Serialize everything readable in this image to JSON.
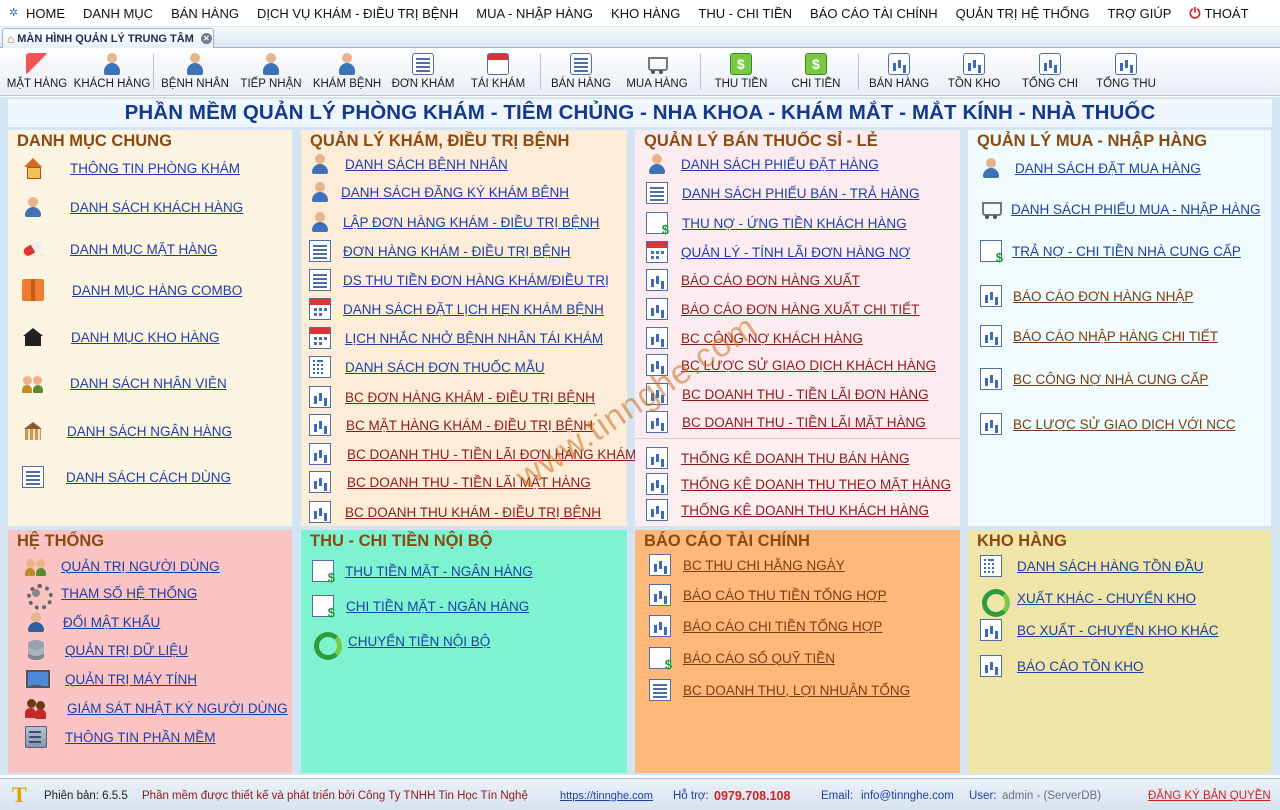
{
  "menu": {
    "items": [
      "HOME",
      "DANH MỤC",
      "BÁN HÀNG",
      "DỊCH VỤ KHÁM - ĐIỀU TRỊ BỆNH",
      "MUA - NHẬP HÀNG",
      "KHO HÀNG",
      "THU - CHI TIỀN",
      "BÁO CÁO TÀI CHÍNH",
      "QUẢN TRỊ HỆ THỐNG",
      "TRỢ GIÚP"
    ],
    "exit_label": "THOÁT"
  },
  "tab": {
    "label": "MÀN HÌNH QUẢN LÝ TRUNG TÂM"
  },
  "toolbar": {
    "buttons": [
      "MẶT HÀNG",
      "KHÁCH HÀNG",
      "BỆNH NHÂN",
      "TIẾP NHẬN",
      "KHÁM BỆNH",
      "ĐƠN KHÁM",
      "TÁI KHÁM",
      "BÁN HÀNG",
      "MUA HÀNG",
      "THU TIỀN",
      "CHI TIỀN",
      "BÁN HÀNG",
      "TỒN KHO",
      "TỔNG CHI",
      "TỔNG THU"
    ]
  },
  "app_title": "PHẦN MỀM QUẢN LÝ PHÒNG KHÁM - TIÊM CHỦNG -  NHA KHOA - KHÁM MẮT - MẮT KÍNH - NHÀ THUỐC",
  "panels": {
    "danh_muc": {
      "title": "DANH MỤC CHUNG",
      "links": [
        "THÔNG TIN PHÒNG KHÁM",
        "DANH SÁCH KHÁCH HÀNG",
        "DANH MỤC MẶT HÀNG",
        "DANH MỤC HÀNG COMBO",
        "DANH MỤC KHO HÀNG",
        "DANH SÁCH NHÂN VIÊN",
        "DANH SÁCH NGÂN HÀNG",
        "DANH SÁCH CÁCH DÙNG"
      ]
    },
    "kham": {
      "title": "QUẢN LÝ KHÁM, ĐIỀU TRỊ BỆNH",
      "links": [
        "DANH SÁCH BỆNH NHÂN",
        "DANH SÁCH ĐĂNG KÝ KHÁM BỆNH",
        "LẬP ĐƠN HÀNG KHÁM - ĐIỀU TRỊ BỆNH",
        "ĐƠN HÀNG KHÁM - ĐIỀU TRỊ BỆNH",
        "DS THU TIỀN ĐƠN HÀNG KHÁM/ĐIỀU TRỊ",
        "DANH SÁCH ĐẶT LỊCH HẸN KHÁM BỆNH",
        "LỊCH NHẮC NHỞ BỆNH NHÂN TÁI KHÁM",
        "DANH SÁCH ĐƠN THUỐC MẪU"
      ],
      "reports": [
        "BC ĐƠN HÀNG KHÁM - ĐIỀU TRỊ BỆNH",
        "BC MẶT HÀNG KHÁM - ĐIỀU TRỊ BỆNH",
        "BC DOANH THU - TIỀN LÃI ĐƠN HÀNG KHÁM",
        "BC DOANH THU - TIỀN LÃI MẶT HÀNG",
        "BC DOANH THU KHÁM - ĐIỀU TRỊ BỆNH"
      ]
    },
    "ban_thuoc": {
      "title": "QUẢN LÝ BÁN THUỐC SỈ - LẺ",
      "links": [
        "DANH SÁCH PHIẾU ĐẶT HÀNG",
        "DANH SÁCH PHIẾU BÁN - TRẢ HÀNG",
        "THU NỢ - ỨNG TIỀN KHÁCH HÀNG",
        "QUẢN LÝ - TÍNH LÃI ĐƠN HÀNG NỢ"
      ],
      "reports": [
        "BÁO CÁO ĐƠN HÀNG XUẤT",
        "BÁO CÁO ĐƠN HÀNG XUẤT CHI TIẾT",
        "BC CÔNG NỢ KHÁCH HÀNG",
        "BC LƯỢC SỬ GIAO DỊCH KHÁCH HÀNG",
        "BC DOANH THU - TIỀN LÃI ĐƠN HÀNG",
        "BC DOANH THU - TIỀN LÃI MẶT HÀNG"
      ],
      "stats": [
        "THỐNG KÊ DOANH THU BÁN HÀNG",
        "THỐNG KÊ DOANH THU THEO MẶT HÀNG",
        "THỐNG KÊ DOANH THU KHÁCH HÀNG"
      ]
    },
    "mua": {
      "title": "QUẢN LÝ MUA - NHẬP HÀNG",
      "links": [
        "DANH SÁCH ĐẶT MUA HÀNG",
        "DANH SÁCH PHIẾU MUA - NHẬP HÀNG",
        "TRẢ NỢ - CHI TIỀN NHÀ CUNG CẤP"
      ],
      "reports": [
        "BÁO CÁO ĐƠN HÀNG NHẬP",
        "BÁO CÁO NHẬP HÀNG CHI TIẾT",
        "BC CÔNG NỢ NHÀ CUNG CẤP",
        "BC LƯỢC SỬ GIAO DỊCH VỚI NCC"
      ]
    },
    "he_thong": {
      "title": "HỆ THỐNG",
      "links": [
        "QUẢN TRỊ NGƯỜI DÙNG",
        "THAM SỐ HỆ THỐNG",
        "ĐỔI MẬT KHẨU",
        "QUẢN TRỊ DỮ LIỆU",
        "QUẢN TRỊ MÁY TÍNH",
        "GIÁM SÁT NHẬT KÝ NGƯỜI DÙNG",
        "THÔNG TIN PHẦN MỀM"
      ]
    },
    "thu_chi": {
      "title": "THU - CHI TIỀN NỘI BỘ",
      "links": [
        "THU TIỀN MẶT - NGÂN HÀNG",
        "CHI TIỀN MẶT - NGÂN HÀNG",
        "CHUYỂN TIỀN NỘI BỘ"
      ]
    },
    "tai_chinh": {
      "title": "BÁO CÁO TÀI CHÍNH",
      "links": [
        "BC THU CHI HẰNG NGÀY",
        "BÁO CÁO THU TIỀN TỔNG HỢP",
        "BÁO CÁO CHI TIỀN TỔNG HỢP",
        "BÁO CÁO SỔ QUỸ TIỀN",
        "BC DOANH THU, LỢI NHUẬN TỔNG"
      ]
    },
    "kho": {
      "title": "KHO HÀNG",
      "links": [
        "DANH SÁCH HÀNG TỒN ĐẦU",
        "XUẤT KHÁC - CHUYỂN KHO",
        "BC XUẤT - CHUYỂN KHO KHÁC",
        "BÁO CÁO TỒN KHO"
      ]
    }
  },
  "watermark": "www.tinnghe.com",
  "status": {
    "version_label": "Phiên bản: 6.5.5",
    "company": "Phần mềm được thiết kế và phát triển bởi Công Ty TNHH Tin Học Tín Nghệ",
    "website": "https://tinnghe.com",
    "support_label": "Hỗ trợ:",
    "phone": "0979.708.108",
    "email_label": "Email:",
    "email": "info@tinnghe.com",
    "user_label": "User:",
    "user": "admin - (ServerDB)",
    "register": "ĐĂNG KÝ BẢN QUYỀN"
  },
  "colors": {
    "panel_danh_muc": "#fdf3e1",
    "panel_kham": "#fdecd7",
    "panel_ban": "#fdecef",
    "panel_mua": "#effbfd",
    "panel_he_thong": "#fbc4c4",
    "panel_thu_chi": "#7ef3cf",
    "panel_tai_chinh": "#fdb87a",
    "panel_kho": "#efe5a6",
    "title_text": "#143a8c",
    "panel_title": "#8a4a12"
  }
}
